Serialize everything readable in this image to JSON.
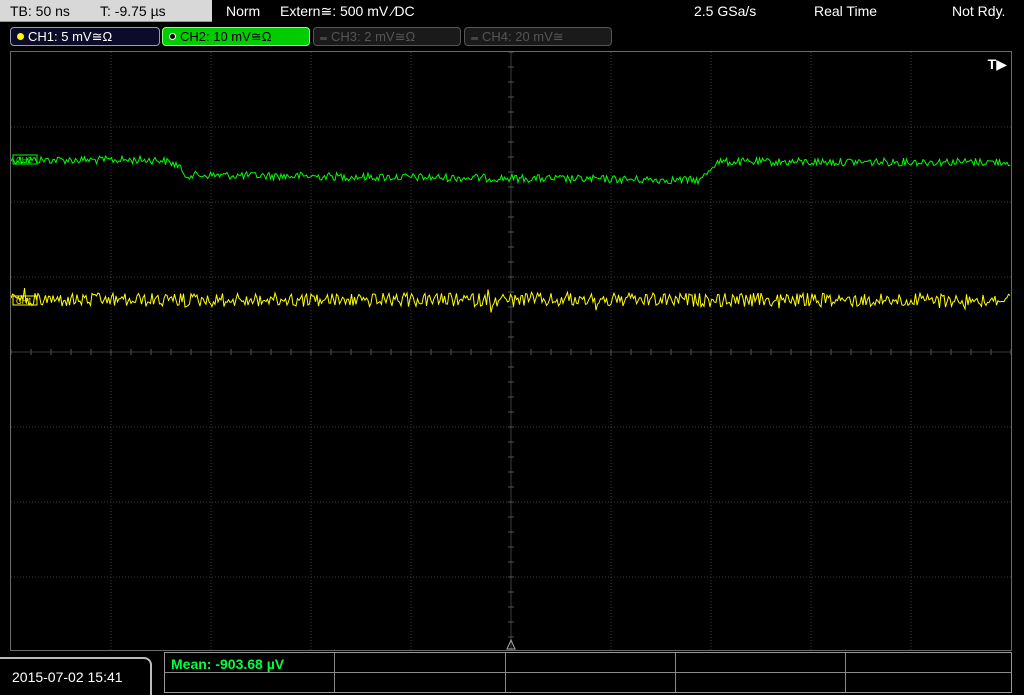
{
  "status_bar": {
    "timebase": "TB: 50 ns",
    "trigger_time": "T: -9.75 µs",
    "trigger_mode": "Norm",
    "trigger_source": "Extern≅: 500 mV ⁄DC",
    "sample_rate": "2.5 GSa/s",
    "acquisition_mode": "Real Time",
    "run_state": "Not Rdy."
  },
  "channels": [
    {
      "label": "CH1: 5 mV≅Ω",
      "color": "#ffff00",
      "active": true
    },
    {
      "label": "CH2: 10 mV≅Ω",
      "color": "#00ff00",
      "active": true
    },
    {
      "label": "CH3: 2 mV≅Ω",
      "color": "#555555",
      "active": false
    },
    {
      "label": "CH4: 20 mV≅",
      "color": "#555555",
      "active": false
    }
  ],
  "screen": {
    "trigger_marker": "T▶",
    "ch1_marker": "CH1",
    "ch2_marker": "CH2"
  },
  "footer": {
    "datetime": "2015-07-02 15:41",
    "measurement": "Mean: -903.68 µV"
  },
  "colors": {
    "ch1_trace": "#ffff00",
    "ch2_trace": "#00ff00",
    "grid": "#3a3a3a"
  }
}
